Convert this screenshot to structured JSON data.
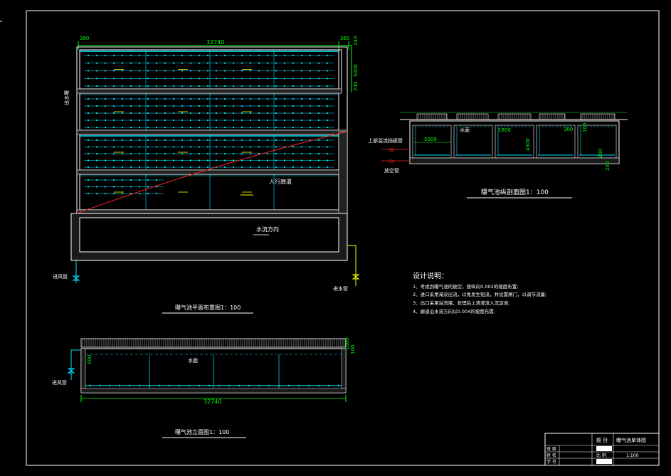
{
  "colors": {
    "background": "#000000",
    "lines": "#ffffff",
    "dimension": "#00ff00",
    "aeration": "#00e5ff",
    "slope": "#ff2020",
    "pipe": "#ffff00",
    "label": "#ffffff"
  },
  "plan": {
    "dim_top_total": "32740",
    "dim_top_left": "380",
    "dim_top_right": "360",
    "dim_right_top": "240",
    "dim_right_mid": "5000",
    "dim_right_bottom": "240",
    "label_left_vertical": "出水堰",
    "walkway_label": "人行廊道",
    "flow_label": "水流方向",
    "air_pipe_label": "进风管",
    "water_pipe_label": "进水管",
    "caption": "曝气池平面布置图1：100"
  },
  "section": {
    "label_upper": "上部溢流挡板管",
    "label_upper_mark": "(8)",
    "label_lower_mark": "(3)",
    "label_drain": "放空管",
    "water_label": "水面",
    "dim_width": "5000",
    "dim_1800": "1800",
    "dim_4500": "4500",
    "dim_300": "300",
    "dim_100": "100",
    "dim_200": "200",
    "dim_bottom": "200",
    "caption": "曝气池纵剖面图1：100"
  },
  "notes": {
    "title": "设计说明：",
    "items": [
      "1、考虑到曝气池的放空，按纵向0.002的坡度布置;",
      "2、进口采用淹没出流，以免发生短流，并设置闸门，以调节流量;",
      "3、出口采用溢流堰，处理后上清液流入沉淀池;",
      "4、廊道沿水流方向以0.004的坡度布置;"
    ]
  },
  "elevation": {
    "water_label": "水面",
    "dim_total": "32740",
    "dim_left": "500",
    "dim_right_top": "1000",
    "dim_right_bottom": "100",
    "air_pipe_label": "进风管",
    "caption": "曝气池立面图1：100"
  },
  "titleblock": {
    "subject_label": "题 目",
    "subject_value": "曝气池单体图",
    "row1": "班 级",
    "row2": "姓 名",
    "row3": "学 号",
    "scale_label": "比 例",
    "scale_value": "1:100",
    "row1_value": "",
    "row2_value": ""
  }
}
